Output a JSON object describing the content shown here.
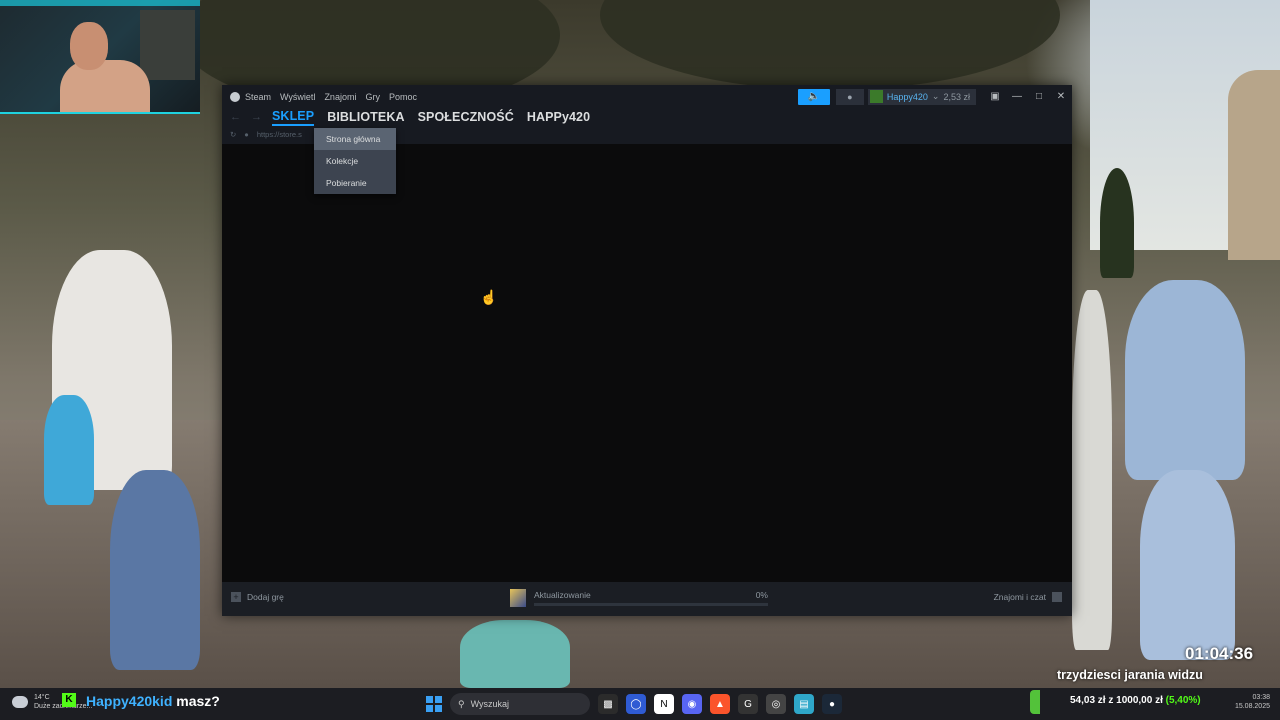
{
  "steam": {
    "title_menu": [
      "Steam",
      "Wyświetl",
      "Znajomi",
      "Gry",
      "Pomoc"
    ],
    "user": {
      "name": "Happy420",
      "wallet": "2,53 zł"
    },
    "nav_tabs": [
      "SKLEP",
      "BIBLIOTEKA",
      "SPOŁECZNOŚĆ",
      "HAPPy420"
    ],
    "active_tab": "SKLEP",
    "url": "https://store.s",
    "dropdown": [
      "Strona główna",
      "Kolekcje",
      "Pobieranie"
    ],
    "bottom": {
      "add_game": "Dodaj grę",
      "download_label": "Aktualizowanie",
      "download_percent_text": "0%",
      "download_progress": 0,
      "friends_chat": "Znajomi i czat"
    },
    "colors": {
      "accent": "#1a9fff",
      "bg": "#0b0b0c",
      "bar": "#171a21"
    }
  },
  "overlay": {
    "timer": "01:04:36",
    "subgoal": "trzydziesci jarania widzu"
  },
  "taskbar": {
    "weather_temp": "14°C",
    "weather_text": "Duże zachmurze...",
    "chat_user": "Happy420kid",
    "chat_msg": "masz?",
    "search_placeholder": "Wyszukaj",
    "donation_text": "54,03 zł z 1000,00 zł",
    "donation_pct": "(5,40%)",
    "clock_time": "03:38",
    "clock_date": "15.08.2025",
    "apps": [
      "terminal-icon",
      "browser-icon",
      "notion-icon",
      "discord-icon",
      "brave-icon",
      "logitech-icon",
      "obs-icon",
      "notepad-icon",
      "steam-icon"
    ]
  }
}
